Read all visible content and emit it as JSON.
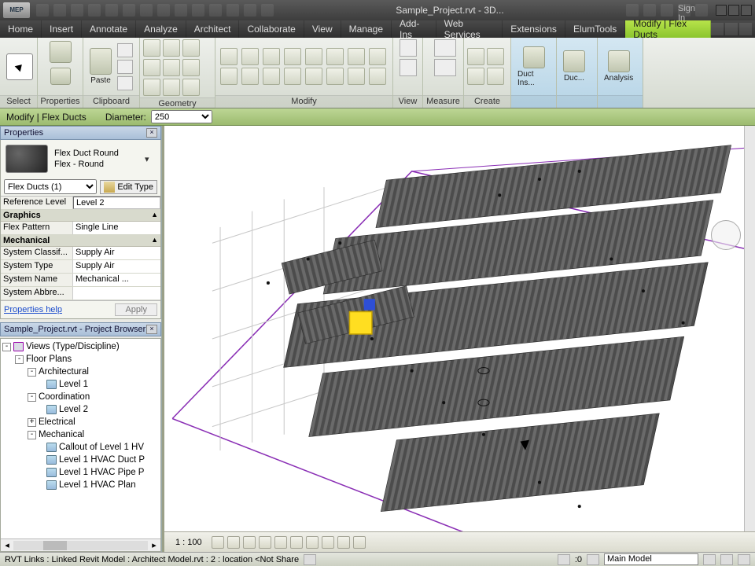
{
  "titlebar": {
    "title": "Sample_Project.rvt - 3D...",
    "signin": "Sign In"
  },
  "menubar": {
    "tabs": [
      "Home",
      "Insert",
      "Annotate",
      "Analyze",
      "Architect",
      "Collaborate",
      "View",
      "Manage",
      "Add-Ins",
      "Web Services",
      "Extensions",
      "ElumTools",
      "Modify | Flex Ducts"
    ],
    "activeIndex": 12
  },
  "ribbon": {
    "panels": {
      "select": "Select",
      "properties": "Properties",
      "clipboard": "Clipboard",
      "paste": "Paste",
      "geometry": "Geometry",
      "modify": "Modify",
      "view": "View",
      "measure": "Measure",
      "create": "Create",
      "ductins": "Duct Ins...",
      "duc": "Duc...",
      "analysis": "Analysis"
    }
  },
  "optbar": {
    "context": "Modify | Flex Ducts",
    "diam_label": "Diameter:",
    "diam_value": "250"
  },
  "properties": {
    "title": "Properties",
    "type_name": "Flex Duct Round",
    "type_sub": "Flex - Round",
    "instance_sel": "Flex Ducts (1)",
    "edit_type": "Edit Type",
    "rows": {
      "ref_level_k": "Reference Level",
      "ref_level_v": "Level 2",
      "graphics": "Graphics",
      "flex_pattern_k": "Flex Pattern",
      "flex_pattern_v": "Single Line",
      "mechanical": "Mechanical",
      "sys_classif_k": "System Classif...",
      "sys_classif_v": "Supply Air",
      "sys_type_k": "System Type",
      "sys_type_v": "Supply Air",
      "sys_name_k": "System Name",
      "sys_name_v": "Mechanical ...",
      "sys_abbr_k": "System Abbre...",
      "sys_abbr_v": ""
    },
    "help": "Properties help",
    "apply": "Apply"
  },
  "browser": {
    "title": "Sample_Project.rvt - Project Browser",
    "nodes": {
      "views": "Views (Type/Discipline)",
      "floorplans": "Floor Plans",
      "architectural": "Architectural",
      "level1a": "Level 1",
      "coordination": "Coordination",
      "level2c": "Level 2",
      "electrical": "Electrical",
      "mechanical": "Mechanical",
      "callout": "Callout of Level 1 HV",
      "hvacduct": "Level 1 HVAC Duct P",
      "hvacpipe": "Level 1 HVAC Pipe P",
      "hvacplan": "Level 1 HVAC Plan"
    }
  },
  "viewctrl": {
    "scale": "1 : 100"
  },
  "status": {
    "msg": "RVT Links : Linked Revit Model : Architect Model.rvt : 2 : location <Not Share",
    "filter": ":0",
    "combo": "Main Model"
  }
}
